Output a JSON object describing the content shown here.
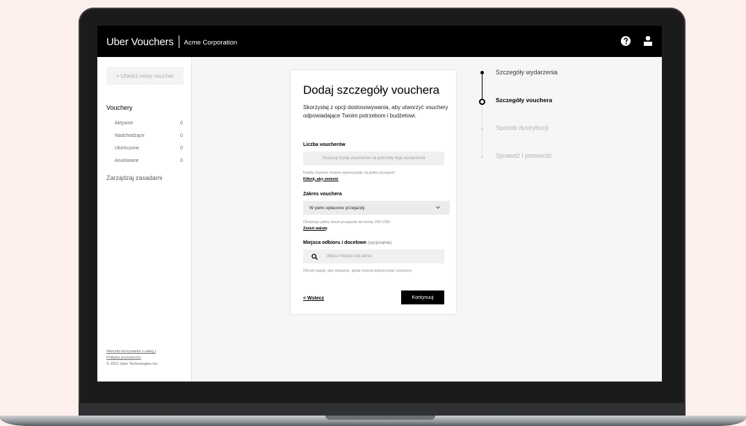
{
  "app": {
    "brand": "Uber Vouchers",
    "company": "Acme Corporation"
  },
  "header": {
    "icons": [
      "help-icon",
      "user-icon"
    ]
  },
  "sidebar": {
    "new_voucher_label": "+ Utwórz nowy voucher",
    "heading": "Vouchery",
    "items": [
      {
        "label": "Aktywne",
        "count": "0"
      },
      {
        "label": "Nadchodzące",
        "count": "0"
      },
      {
        "label": "Ukończone",
        "count": "0"
      },
      {
        "label": "Anulowane",
        "count": "0"
      }
    ],
    "manage_rules": "Zarządzaj zasadami",
    "footer": {
      "terms": "Warunki korzystania z usług |",
      "privacy": "Polityka prywatności",
      "copyright": "© 2021 Uber Technologies Inc."
    }
  },
  "form": {
    "title": "Dodaj szczegóły vouchera",
    "description": "Skorzystaj z opcji dostosowywania, aby utworzyć vouchery odpowiadające Twoim potrzebom i budżetowi.",
    "count": {
      "label": "Liczba voucherów",
      "placeholder": "Oszacuj liczbę voucherów na potrzeby tego wydarzenia",
      "hint": "Każdy voucher można wykorzystać na jeden przejazd.",
      "hint_link": "Kliknij, aby zmienić"
    },
    "scope": {
      "label": "Zakres vouchera",
      "selected": "W pełni opłacone przejazdy",
      "hint": "Obejmuje pełny koszt przejazdu do kwoty 200 USD.",
      "hint_link": "Zmień walutę"
    },
    "places": {
      "label": "Miejsca odbioru i docelowe",
      "optional": "(opcjonalnie)",
      "placeholder": "Wpisz miejsce lub adres",
      "hint": "Określ reguły, aby wskazać, gdzie można wykorzystać vouchery"
    },
    "back_label": "< Wstecz",
    "continue_label": "Kontynuuj"
  },
  "stepper": {
    "steps": [
      {
        "label": "Szczegóły wydarzenia",
        "state": "done"
      },
      {
        "label": "Szczegóły vouchera",
        "state": "current"
      },
      {
        "label": "Sposób dystrybucji",
        "state": "upcoming"
      },
      {
        "label": "Sprawdź i potwierdź",
        "state": "upcoming"
      }
    ]
  },
  "colors": {
    "background": "#fcefec",
    "header": "#000000",
    "primary_button": "#000000",
    "inactive_text": "#b3b3b3"
  }
}
